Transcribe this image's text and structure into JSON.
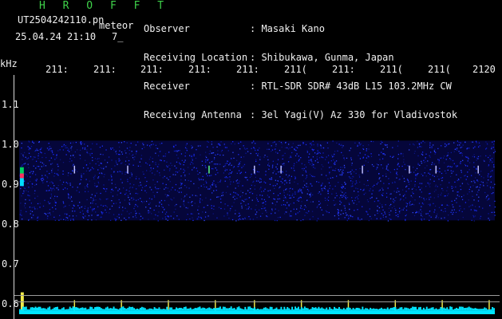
{
  "header": {
    "title": "H R O F F T",
    "filename": "UT2504242110.pn",
    "type": "meteor",
    "date": "25.04.24 21:10",
    "number": "7_"
  },
  "info": {
    "labels": [
      "Observer",
      "Receiving Location",
      "Receiver",
      "Receiving Antenna"
    ],
    "values": [
      ": Masaki Kano",
      ": Shibukawa, Gunma, Japan",
      ": RTL-SDR SDR# 43dB L15 103.2MHz CW",
      ": 3el Yagi(V) Az 330 for Vladivostok"
    ]
  },
  "axes": {
    "unit": "kHz",
    "y_ticks": [
      "1.1",
      "1.0",
      "0.9",
      "0.8",
      "0.7",
      "0.6"
    ],
    "x_ticks": [
      "211:",
      "211:",
      "211:",
      "211:",
      "211:",
      "211(",
      "211:",
      "211(",
      "211(",
      "2120"
    ]
  },
  "colors": {
    "title": "#3fd24a",
    "text": "#f0f0f0",
    "time_ticks": "#f0ea4a",
    "signal": "#00e5ff",
    "noise": "#1a2aff"
  }
}
